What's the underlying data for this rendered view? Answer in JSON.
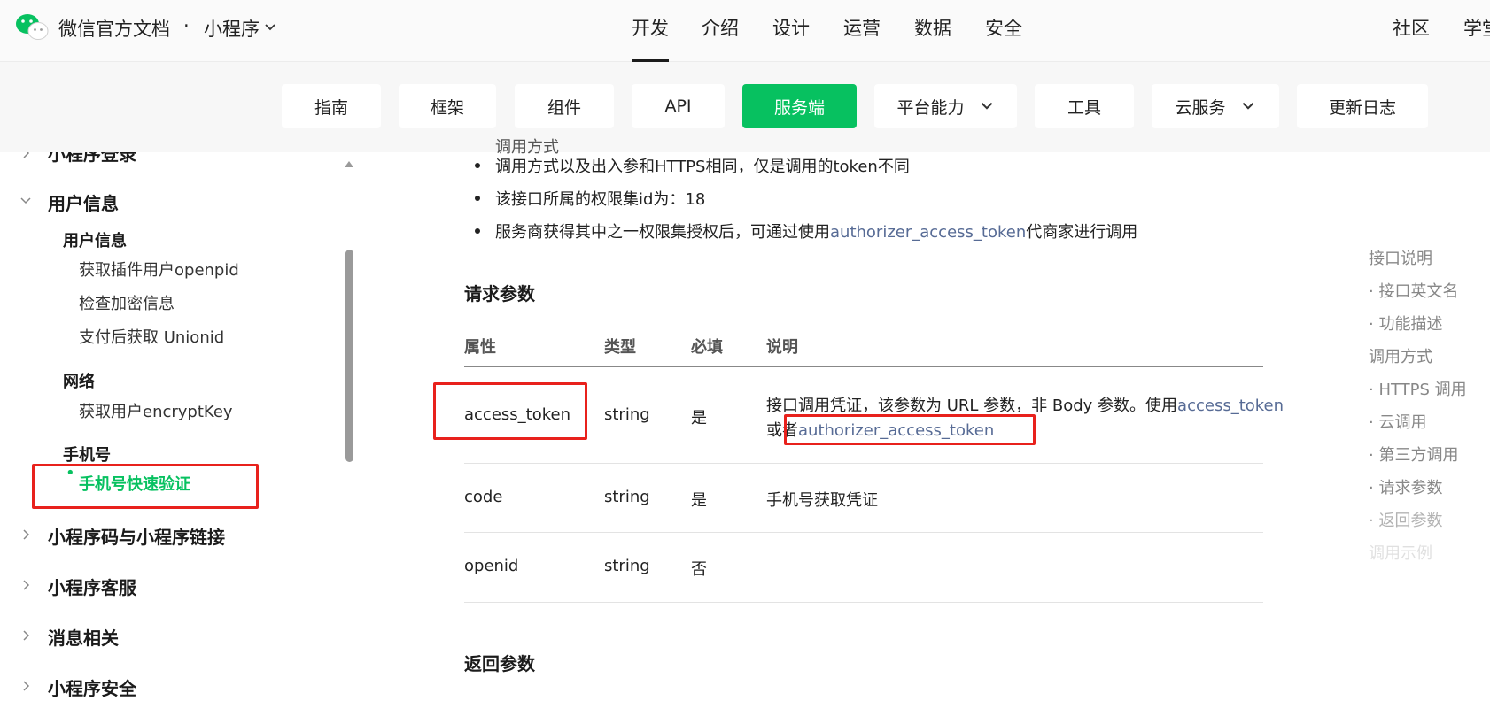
{
  "header": {
    "brand": "微信官方文档",
    "separator": "·",
    "product": "小程序",
    "nav": [
      "开发",
      "介绍",
      "设计",
      "运营",
      "数据",
      "安全"
    ],
    "active_nav": "开发",
    "right": [
      "社区",
      "学堂"
    ]
  },
  "subnav": {
    "items": [
      {
        "label": "指南",
        "dropdown": false
      },
      {
        "label": "框架",
        "dropdown": false
      },
      {
        "label": "组件",
        "dropdown": false
      },
      {
        "label": "API",
        "dropdown": false
      },
      {
        "label": "服务端",
        "dropdown": false,
        "active": true
      },
      {
        "label": "平台能力",
        "dropdown": true
      },
      {
        "label": "工具",
        "dropdown": false
      },
      {
        "label": "云服务",
        "dropdown": true
      },
      {
        "label": "更新日志",
        "dropdown": false
      }
    ],
    "active_color": "#07c160"
  },
  "sidebar": {
    "partial_top": "小程序登录",
    "group_user": "用户信息",
    "sub_user": "用户信息",
    "items_user": [
      "获取插件用户openpid",
      "检查加密信息",
      "支付后获取 Unionid"
    ],
    "sub_network": "网络",
    "items_network": [
      "获取用户encryptKey"
    ],
    "sub_phone": "手机号",
    "active_item": "手机号快速验证",
    "groups_after": [
      "小程序码与小程序链接",
      "小程序客服",
      "消息相关",
      "小程序安全"
    ]
  },
  "content": {
    "partial_top": "调用方式",
    "bullets": [
      "调用方式以及出入参和HTTPS相同，仅是调用的token不同",
      "该接口所属的权限集id为：18"
    ],
    "bullet3_prefix": "服务商获得其中之一权限集授权后，可通过使用",
    "bullet3_link": "authorizer_access_token",
    "bullet3_suffix": "代商家进行调用",
    "request_title": "请求参数",
    "columns": [
      "属性",
      "类型",
      "必填",
      "说明"
    ],
    "rows": [
      {
        "name": "access_token",
        "type": "string",
        "required": "是",
        "desc_prefix": "接口调用凭证，该参数为 URL 参数，非 Body 参数。使用",
        "desc_link1": "access_token",
        "desc_mid": "或者",
        "desc_link2": "authorizer_access_token"
      },
      {
        "name": "code",
        "type": "string",
        "required": "是",
        "desc_link": "手机号获取凭证"
      },
      {
        "name": "openid",
        "type": "string",
        "required": "否",
        "desc": ""
      }
    ],
    "response_title": "返回参数"
  },
  "toc": {
    "items": [
      "接口说明",
      "· 接口英文名",
      "· 功能描述",
      "调用方式",
      "· HTTPS 调用",
      "· 云调用",
      "· 第三方调用",
      "· 请求参数",
      "· 返回参数",
      "调用示例"
    ]
  },
  "colors": {
    "link": "#576b95",
    "annotation": "#e8211c"
  }
}
